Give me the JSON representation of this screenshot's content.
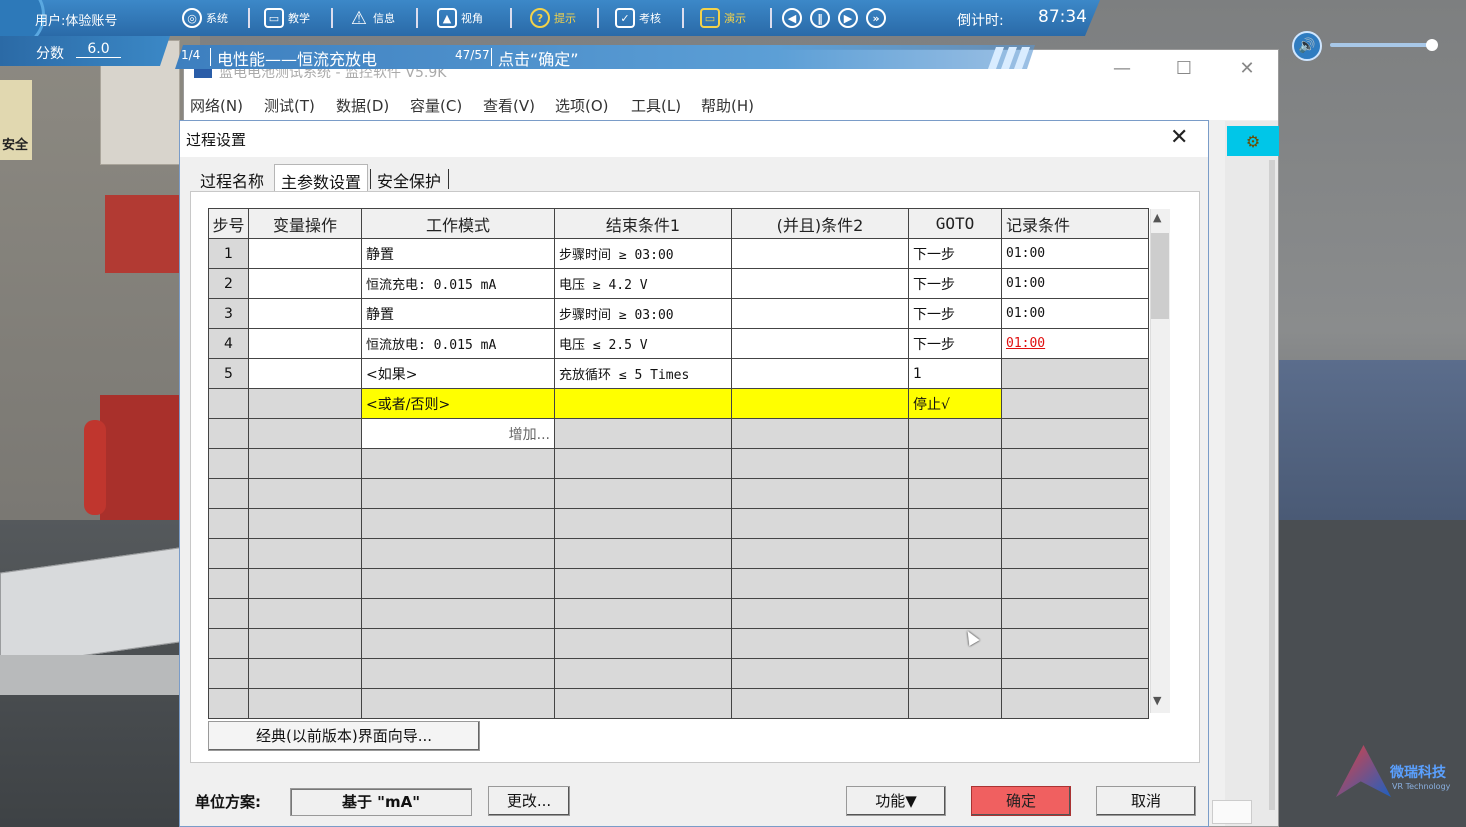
{
  "hud": {
    "user_label": "用户:体验账号",
    "score_label": "分数",
    "score_value": "6.0",
    "buttons": [
      {
        "label": "系统",
        "icon": "globe-icon"
      },
      {
        "label": "教学",
        "icon": "teach-icon"
      },
      {
        "label": "信息",
        "icon": "warning-icon"
      },
      {
        "label": "视角",
        "icon": "image-icon"
      },
      {
        "label": "提示",
        "icon": "question-icon"
      },
      {
        "label": "考核",
        "icon": "check-icon"
      },
      {
        "label": "演示",
        "icon": "monitor-icon"
      }
    ],
    "playback": [
      "rewind-icon",
      "pause-icon",
      "play-icon",
      "fast-forward-icon"
    ],
    "countdown_label": "倒计时:",
    "countdown_value": "87:34"
  },
  "step_banner": {
    "index": "1/4",
    "title": "电性能——恒流充放电",
    "progress": "47/57",
    "instruction": "点击“确定”"
  },
  "app": {
    "title": "蓝电电池测试系统 - 监控软件 V5.9K",
    "menu": [
      "网络(N)",
      "测试(T)",
      "数据(D)",
      "容量(C)",
      "查看(V)",
      "选项(O)",
      "工具(L)",
      "帮助(H)"
    ],
    "accent_color": "#00c6e8"
  },
  "dialog": {
    "title": "过程设置",
    "tabs": [
      "过程名称",
      "主参数设置",
      "安全保护"
    ],
    "active_tab": "主参数设置",
    "columns": [
      "步号",
      "变量操作",
      "工作模式",
      "结束条件1",
      "(并且)条件2",
      "GOTO",
      "记录条件"
    ],
    "rows": [
      {
        "step": "1",
        "var": "",
        "mode": "静置",
        "mode_style": "",
        "end1": "步骤时间 ≥ 03:00",
        "cond2": "",
        "goto": "下一步",
        "record": "01:00"
      },
      {
        "step": "2",
        "var": "",
        "mode": "恒流充电: 0.015 mA",
        "mode_style": "blue",
        "end1": "电压 ≥ 4.2 V",
        "cond2": "",
        "goto": "下一步",
        "record": "01:00"
      },
      {
        "step": "3",
        "var": "",
        "mode": "静置",
        "mode_style": "",
        "end1": "步骤时间 ≥ 03:00",
        "cond2": "",
        "goto": "下一步",
        "record": "01:00"
      },
      {
        "step": "4",
        "var": "",
        "mode": "恒流放电: 0.015 mA",
        "mode_style": "red",
        "end1": "电压 ≤ 2.5 V",
        "cond2": "",
        "goto": "下一步",
        "record": "01:00"
      },
      {
        "step": "5",
        "var": "",
        "mode": "<如果>",
        "mode_style": "",
        "end1": "充放循环 ≤ 5 Times",
        "cond2": "",
        "goto": "1",
        "record": ""
      },
      {
        "step": "",
        "var": "",
        "mode": "<或者/否则>",
        "mode_style": "yellow",
        "end1": "",
        "cond2": "",
        "goto": "停止√",
        "record": ""
      }
    ],
    "add_label": "增加...",
    "wizard_button": "经典(以前版本)界面向导...",
    "unit_label": "单位方案:",
    "unit_value": "基于 \"mA\"",
    "change_button": "更改...",
    "function_button": "功能▼",
    "ok_button": "确定",
    "cancel_button": "取消"
  },
  "background": {
    "sign_text": "安全"
  },
  "logo": {
    "name": "微瑞科技",
    "sub": "VR Technology"
  }
}
